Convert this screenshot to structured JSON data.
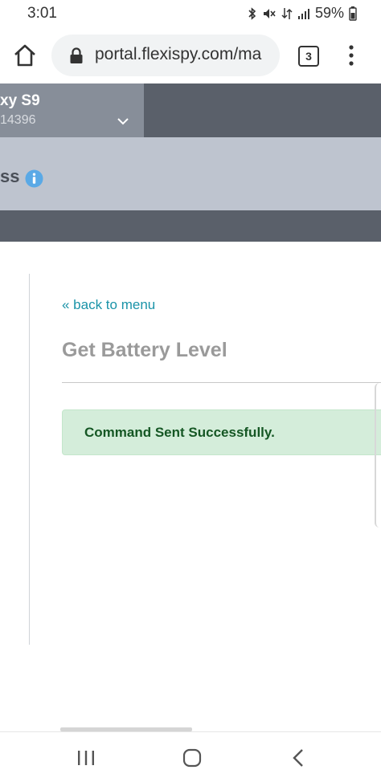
{
  "status_bar": {
    "time": "3:01",
    "battery": "59%"
  },
  "browser": {
    "url": "portal.flexispy.com/ma",
    "tab_count": "3"
  },
  "header": {
    "device_name": "xy S9",
    "device_id": "14396",
    "page_section": "ss"
  },
  "main": {
    "back_link": "« back to menu",
    "heading": "Get Battery Level",
    "alert_message": "Command Sent Successfully."
  },
  "colors": {
    "link": "#1a93a8",
    "success_bg": "#d4edda",
    "success_text": "#155724",
    "header_dark": "#5a606a",
    "header_light": "#bec4cf"
  }
}
